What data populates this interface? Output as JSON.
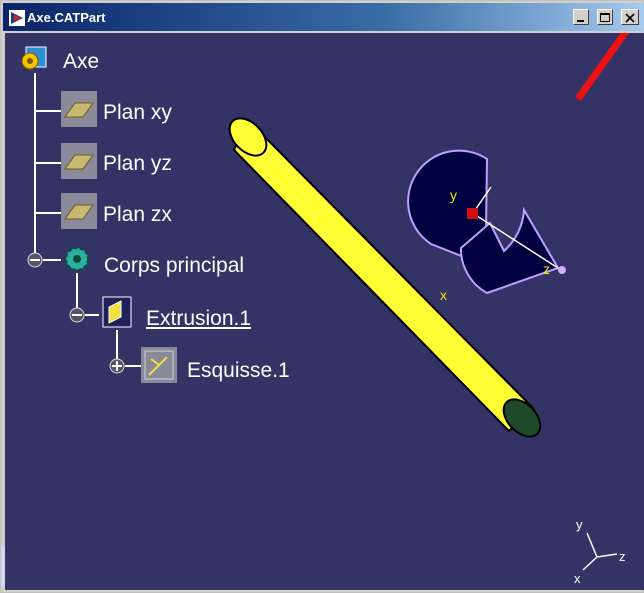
{
  "window": {
    "title": "Axe.CATPart"
  },
  "tree": {
    "root": "Axe",
    "planes": [
      "Plan xy",
      "Plan yz",
      "Plan zx"
    ],
    "body": "Corps principal",
    "feature": "Extrusion.1",
    "sketch": "Esquisse.1"
  },
  "compass_labels": {
    "x": "x",
    "y": "y",
    "z": "z"
  },
  "axis_labels": {
    "x": "x",
    "y": "y",
    "z": "z"
  },
  "colors": {
    "viewport": "#333366",
    "cylinder": "#ffff33",
    "cylinder_end": "#1f4a2a",
    "compass_fill": "#000040",
    "red_line": "#ee1111"
  }
}
